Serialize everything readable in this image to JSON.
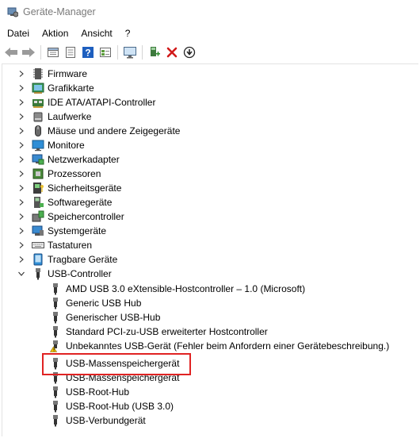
{
  "window": {
    "title": "Geräte-Manager"
  },
  "menu": [
    "Datei",
    "Aktion",
    "Ansicht",
    "?"
  ],
  "toolbar": [
    {
      "name": "back-arrow-icon",
      "sep_after": false
    },
    {
      "name": "forward-arrow-icon",
      "sep_after": true
    },
    {
      "name": "properties-icon",
      "sep_after": false
    },
    {
      "name": "update-driver-list-icon",
      "sep_after": false
    },
    {
      "name": "help-icon",
      "sep_after": false
    },
    {
      "name": "show-hidden-icon",
      "sep_after": true
    },
    {
      "name": "monitor-scan-icon",
      "sep_after": true
    },
    {
      "name": "add-driver-icon",
      "sep_after": false
    },
    {
      "name": "uninstall-x-icon",
      "sep_after": false
    },
    {
      "name": "disable-device-icon",
      "sep_after": false
    }
  ],
  "tree": {
    "categories": [
      {
        "label": "Firmware",
        "icon": "firmware-icon",
        "expanded": false
      },
      {
        "label": "Grafikkarte",
        "icon": "display-adapter-icon",
        "expanded": false
      },
      {
        "label": "IDE ATA/ATAPI-Controller",
        "icon": "ide-controller-icon",
        "expanded": false
      },
      {
        "label": "Laufwerke",
        "icon": "disk-drive-icon",
        "expanded": false
      },
      {
        "label": "Mäuse und andere Zeigegeräte",
        "icon": "mouse-icon",
        "expanded": false
      },
      {
        "label": "Monitore",
        "icon": "monitor-icon",
        "expanded": false
      },
      {
        "label": "Netzwerkadapter",
        "icon": "network-adapter-icon",
        "expanded": false
      },
      {
        "label": "Prozessoren",
        "icon": "processor-icon",
        "expanded": false
      },
      {
        "label": "Sicherheitsgeräte",
        "icon": "security-device-icon",
        "expanded": false
      },
      {
        "label": "Softwaregeräte",
        "icon": "software-device-icon",
        "expanded": false
      },
      {
        "label": "Speichercontroller",
        "icon": "storage-controller-icon",
        "expanded": false
      },
      {
        "label": "Systemgeräte",
        "icon": "system-device-icon",
        "expanded": false
      },
      {
        "label": "Tastaturen",
        "icon": "keyboard-icon",
        "expanded": false
      },
      {
        "label": "Tragbare Geräte",
        "icon": "portable-device-icon",
        "expanded": false
      },
      {
        "label": "USB-Controller",
        "icon": "usb-plug-icon",
        "expanded": true
      }
    ],
    "usb_children": [
      {
        "label": "AMD USB 3.0 eXtensible-Hostcontroller – 1.0 (Microsoft)",
        "warning": false
      },
      {
        "label": "Generic USB Hub",
        "warning": false
      },
      {
        "label": "Generischer USB-Hub",
        "warning": false
      },
      {
        "label": "Standard PCI-zu-USB erweiterter Hostcontroller",
        "warning": false
      },
      {
        "label": "Unbekanntes USB-Gerät (Fehler beim Anfordern einer Gerätebeschreibung.)",
        "warning": true
      },
      {
        "label": "USB-Massenspeichergerät",
        "warning": false,
        "highlighted": true
      },
      {
        "label": "USB-Massenspeichergerät",
        "warning": false
      },
      {
        "label": "USB-Root-Hub",
        "warning": false
      },
      {
        "label": "USB-Root-Hub (USB 3.0)",
        "warning": false
      },
      {
        "label": "USB-Verbundgerät",
        "warning": false
      }
    ]
  },
  "colors": {
    "highlight_border": "#e02323",
    "help_blue": "#1e5fbf",
    "x_red": "#d11a1a",
    "warning_yellow": "#f2c200"
  }
}
